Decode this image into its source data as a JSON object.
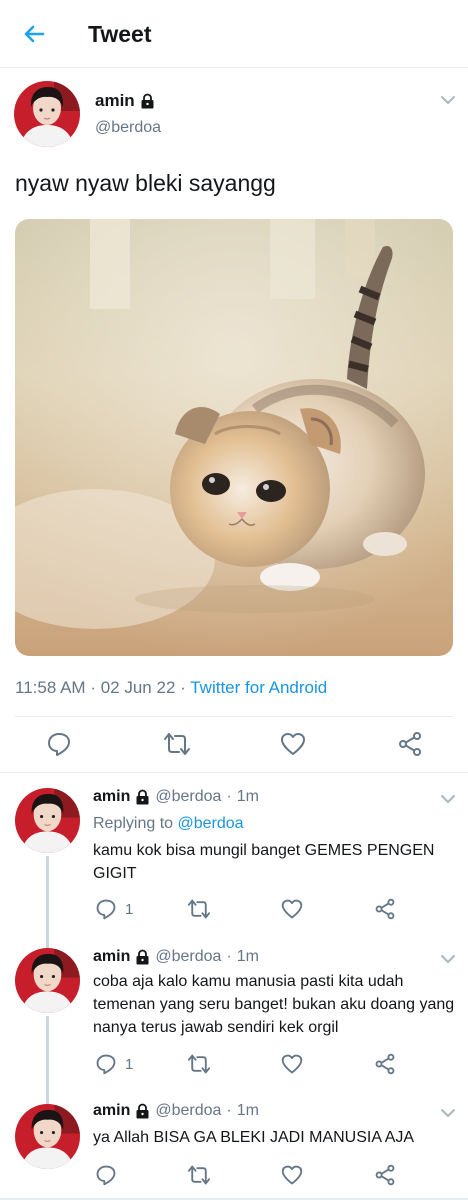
{
  "header": {
    "title": "Tweet",
    "back_icon": "arrow-left-icon"
  },
  "colors": {
    "accent": "#1da1f2",
    "secondary_text": "#657786",
    "divider": "#e6ecf0",
    "thread_line": "#ccd6dd"
  },
  "main_tweet": {
    "name": "amin",
    "handle": "@berdoa",
    "text": "nyaw nyaw bleki sayangg",
    "time": "11:58 AM",
    "separator": "·",
    "date": "02 Jun 22",
    "source": "Twitter for Android"
  },
  "replies": [
    {
      "name": "amin",
      "handle": "@berdoa",
      "separator": "·",
      "time": "1m",
      "replying_prefix": "Replying to",
      "replying_to": "@berdoa",
      "text": "kamu kok bisa mungil banget GEMES PENGEN GIGIT",
      "reply_count": "1"
    },
    {
      "name": "amin",
      "handle": "@berdoa",
      "separator": "·",
      "time": "1m",
      "text": "coba aja kalo kamu manusia pasti kita udah temenan yang seru banget! bukan aku doang yang nanya terus jawab sendiri kek orgil",
      "reply_count": "1"
    },
    {
      "name": "amin",
      "handle": "@berdoa",
      "separator": "·",
      "time": "1m",
      "text": "ya Allah BISA GA BLEKI JADI MANUSIA AJA"
    }
  ]
}
